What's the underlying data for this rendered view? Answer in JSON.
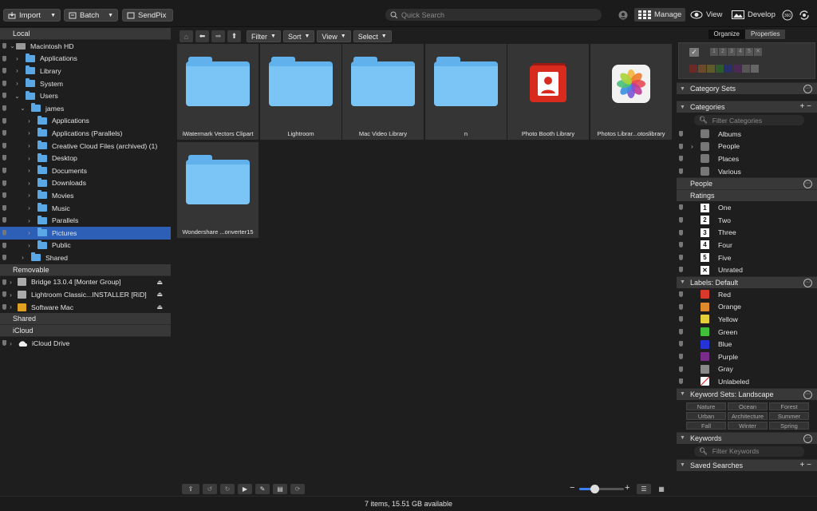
{
  "toolbar": {
    "import_label": "Import",
    "batch_label": "Batch",
    "sendpix_label": "SendPix",
    "search_placeholder": "Quick Search",
    "modes": [
      {
        "label": "Manage",
        "active": true
      },
      {
        "label": "View",
        "active": false
      },
      {
        "label": "Develop",
        "active": false
      }
    ]
  },
  "sidebar": {
    "local": "Local",
    "macintosh_hd": "Macintosh HD",
    "items": [
      "Applications",
      "Library",
      "System",
      "Users"
    ],
    "user": "james",
    "user_items": [
      "Applications",
      "Applications (Parallels)",
      "Creative Cloud Files (archived) (1)",
      "Desktop",
      "Documents",
      "Downloads",
      "Movies",
      "Music",
      "Parallels",
      "Pictures",
      "Public"
    ],
    "shared_folder": "Shared",
    "removable": "Removable",
    "removable_items": [
      "Bridge 13.0.4 [Monter Group]",
      "Lightroom Classic...INSTALLER [RiD]",
      "Software Mac"
    ],
    "shared": "Shared",
    "icloud": "iCloud",
    "icloud_drive": "iCloud Drive",
    "selected": "Pictures"
  },
  "browser": {
    "filter_label": "Filter",
    "sort_label": "Sort",
    "view_label": "View",
    "select_label": "Select",
    "tiles": [
      {
        "name": "iWatermark Vectors Clipart",
        "kind": "folder"
      },
      {
        "name": "Lightroom",
        "kind": "folder"
      },
      {
        "name": "Mac Video Library",
        "kind": "folder"
      },
      {
        "name": "n",
        "kind": "folder"
      },
      {
        "name": "Photo Booth Library",
        "kind": "photobooth"
      },
      {
        "name": "Photos Librar...otoslibrary",
        "kind": "photos"
      },
      {
        "name": "Wondershare ...onverter15",
        "kind": "folder"
      }
    ]
  },
  "status": {
    "text": "7 items, 15.51 GB available"
  },
  "inspector": {
    "tab_organize": "Organize",
    "tab_properties": "Properties",
    "rating_digits": [
      "1",
      "2",
      "3",
      "4",
      "5"
    ],
    "category_sets": "Category Sets",
    "categories": "Categories",
    "filter_categories": "Filter Categories",
    "category_items": [
      "Albums",
      "People",
      "Places",
      "Various"
    ],
    "people": "People",
    "ratings": "Ratings",
    "rating_items": [
      {
        "num": "1",
        "label": "One"
      },
      {
        "num": "2",
        "label": "Two"
      },
      {
        "num": "3",
        "label": "Three"
      },
      {
        "num": "4",
        "label": "Four"
      },
      {
        "num": "5",
        "label": "Five"
      },
      {
        "num": "✕",
        "label": "Unrated"
      }
    ],
    "labels_header": "Labels: Default",
    "label_items": [
      {
        "label": "Red",
        "color": "#d93a2b"
      },
      {
        "label": "Orange",
        "color": "#e0892b"
      },
      {
        "label": "Yellow",
        "color": "#e3cf3a"
      },
      {
        "label": "Green",
        "color": "#3fbf3a"
      },
      {
        "label": "Blue",
        "color": "#2434d6"
      },
      {
        "label": "Purple",
        "color": "#7a2c8a"
      },
      {
        "label": "Gray",
        "color": "#8a8a8a"
      },
      {
        "label": "Unlabeled",
        "color": "#ffffff"
      }
    ],
    "keyword_sets": "Keyword Sets: Landscape",
    "keywords_grid": [
      "Nature",
      "Ocean",
      "Forest",
      "Urban",
      "Architecture",
      "Summer",
      "Fall",
      "Winter",
      "Spring"
    ],
    "keywords": "Keywords",
    "filter_keywords": "Filter Keywords",
    "saved_searches": "Saved Searches"
  }
}
